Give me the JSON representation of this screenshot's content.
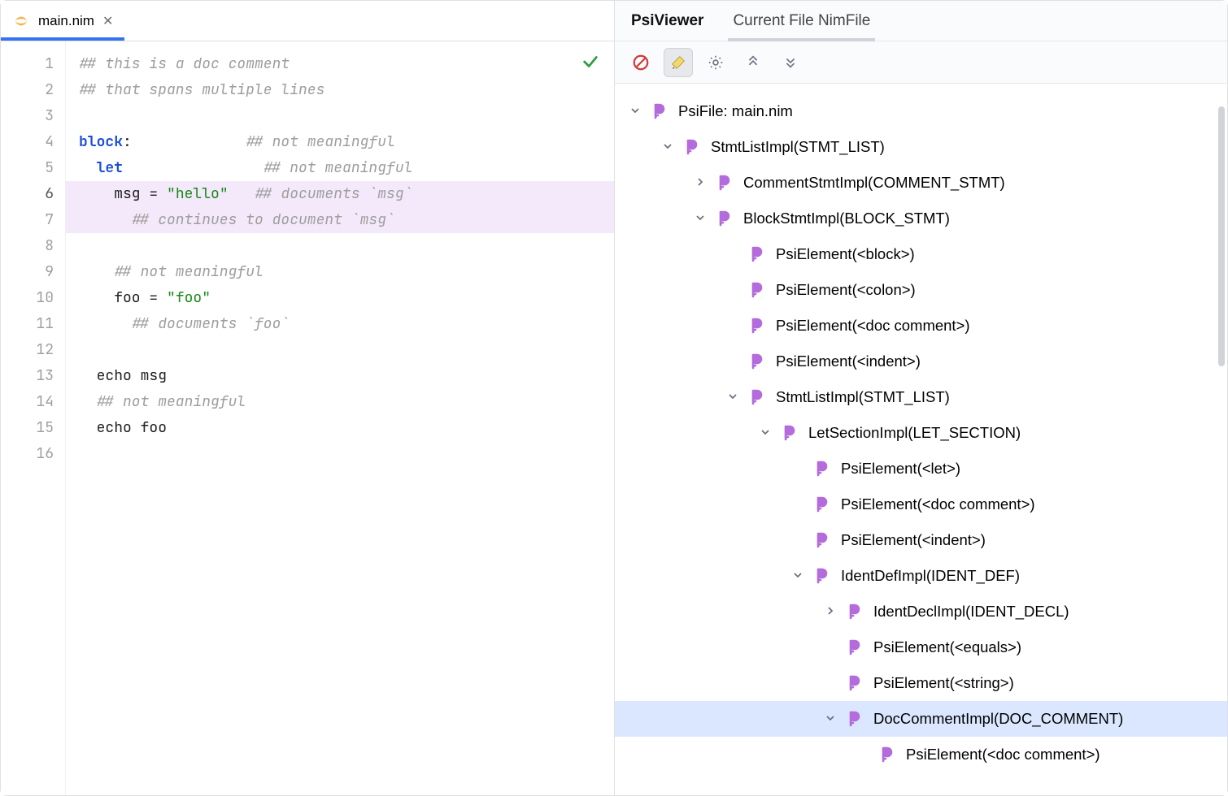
{
  "editor": {
    "tab": {
      "filename": "main.nim"
    },
    "lines": [
      {
        "n": 1,
        "tokens": [
          [
            "comment",
            "## this is a doc comment"
          ]
        ]
      },
      {
        "n": 2,
        "tokens": [
          [
            "comment",
            "## that spans multiple lines"
          ]
        ]
      },
      {
        "n": 3,
        "tokens": []
      },
      {
        "n": 4,
        "tokens": [
          [
            "keyword",
            "block"
          ],
          [
            "ident",
            ":"
          ],
          [
            "pad",
            "             "
          ],
          [
            "comment",
            "## not meaningful"
          ]
        ]
      },
      {
        "n": 5,
        "tokens": [
          [
            "pad",
            "  "
          ],
          [
            "keyword",
            "let"
          ],
          [
            "pad",
            "                "
          ],
          [
            "comment",
            "## not meaningful"
          ]
        ]
      },
      {
        "n": 6,
        "tokens": [
          [
            "pad",
            "    "
          ],
          [
            "ident",
            "msg = "
          ],
          [
            "string",
            "\"hello\""
          ],
          [
            "pad",
            "   "
          ],
          [
            "comment",
            "## documents `msg`"
          ]
        ],
        "highlight": true,
        "current": true
      },
      {
        "n": 7,
        "tokens": [
          [
            "pad",
            "      "
          ],
          [
            "comment",
            "## continues to document `msg`"
          ]
        ],
        "highlight": true
      },
      {
        "n": 8,
        "tokens": []
      },
      {
        "n": 9,
        "tokens": [
          [
            "pad",
            "    "
          ],
          [
            "comment",
            "## not meaningful"
          ]
        ]
      },
      {
        "n": 10,
        "tokens": [
          [
            "pad",
            "    "
          ],
          [
            "ident",
            "foo = "
          ],
          [
            "string",
            "\"foo\""
          ]
        ]
      },
      {
        "n": 11,
        "tokens": [
          [
            "pad",
            "      "
          ],
          [
            "comment",
            "## documents `foo`"
          ]
        ]
      },
      {
        "n": 12,
        "tokens": []
      },
      {
        "n": 13,
        "tokens": [
          [
            "pad",
            "  "
          ],
          [
            "ident",
            "echo msg"
          ]
        ]
      },
      {
        "n": 14,
        "tokens": [
          [
            "pad",
            "  "
          ],
          [
            "comment",
            "## not meaningful"
          ]
        ]
      },
      {
        "n": 15,
        "tokens": [
          [
            "pad",
            "  "
          ],
          [
            "ident",
            "echo foo"
          ]
        ]
      },
      {
        "n": 16,
        "tokens": []
      }
    ]
  },
  "psi": {
    "tabs": {
      "active": "PsiViewer",
      "inactive": "Current File NimFile"
    },
    "toolbar_icons": [
      "block-icon",
      "highlight-icon",
      "settings-icon",
      "collapse-icon",
      "expand-icon"
    ],
    "tree": [
      {
        "indent": 0,
        "arrow": "down",
        "label": "PsiFile: main.nim"
      },
      {
        "indent": 1,
        "arrow": "down",
        "label": "StmtListImpl(STMT_LIST)"
      },
      {
        "indent": 2,
        "arrow": "right",
        "label": "CommentStmtImpl(COMMENT_STMT)"
      },
      {
        "indent": 2,
        "arrow": "down",
        "label": "BlockStmtImpl(BLOCK_STMT)"
      },
      {
        "indent": 3,
        "arrow": "",
        "label": "PsiElement(<block>)"
      },
      {
        "indent": 3,
        "arrow": "",
        "label": "PsiElement(<colon>)"
      },
      {
        "indent": 3,
        "arrow": "",
        "label": "PsiElement(<doc comment>)"
      },
      {
        "indent": 3,
        "arrow": "",
        "label": "PsiElement(<indent>)"
      },
      {
        "indent": 3,
        "arrow": "down",
        "label": "StmtListImpl(STMT_LIST)"
      },
      {
        "indent": 4,
        "arrow": "down",
        "label": "LetSectionImpl(LET_SECTION)"
      },
      {
        "indent": 5,
        "arrow": "",
        "label": "PsiElement(<let>)"
      },
      {
        "indent": 5,
        "arrow": "",
        "label": "PsiElement(<doc comment>)"
      },
      {
        "indent": 5,
        "arrow": "",
        "label": "PsiElement(<indent>)"
      },
      {
        "indent": 5,
        "arrow": "down",
        "label": "IdentDefImpl(IDENT_DEF)"
      },
      {
        "indent": 6,
        "arrow": "right",
        "label": "IdentDeclImpl(IDENT_DECL)"
      },
      {
        "indent": 6,
        "arrow": "",
        "label": "PsiElement(<equals>)"
      },
      {
        "indent": 6,
        "arrow": "",
        "label": "PsiElement(<string>)"
      },
      {
        "indent": 6,
        "arrow": "down",
        "label": "DocCommentImpl(DOC_COMMENT)",
        "selected": true
      },
      {
        "indent": 7,
        "arrow": "",
        "label": "PsiElement(<doc comment>)"
      }
    ]
  }
}
